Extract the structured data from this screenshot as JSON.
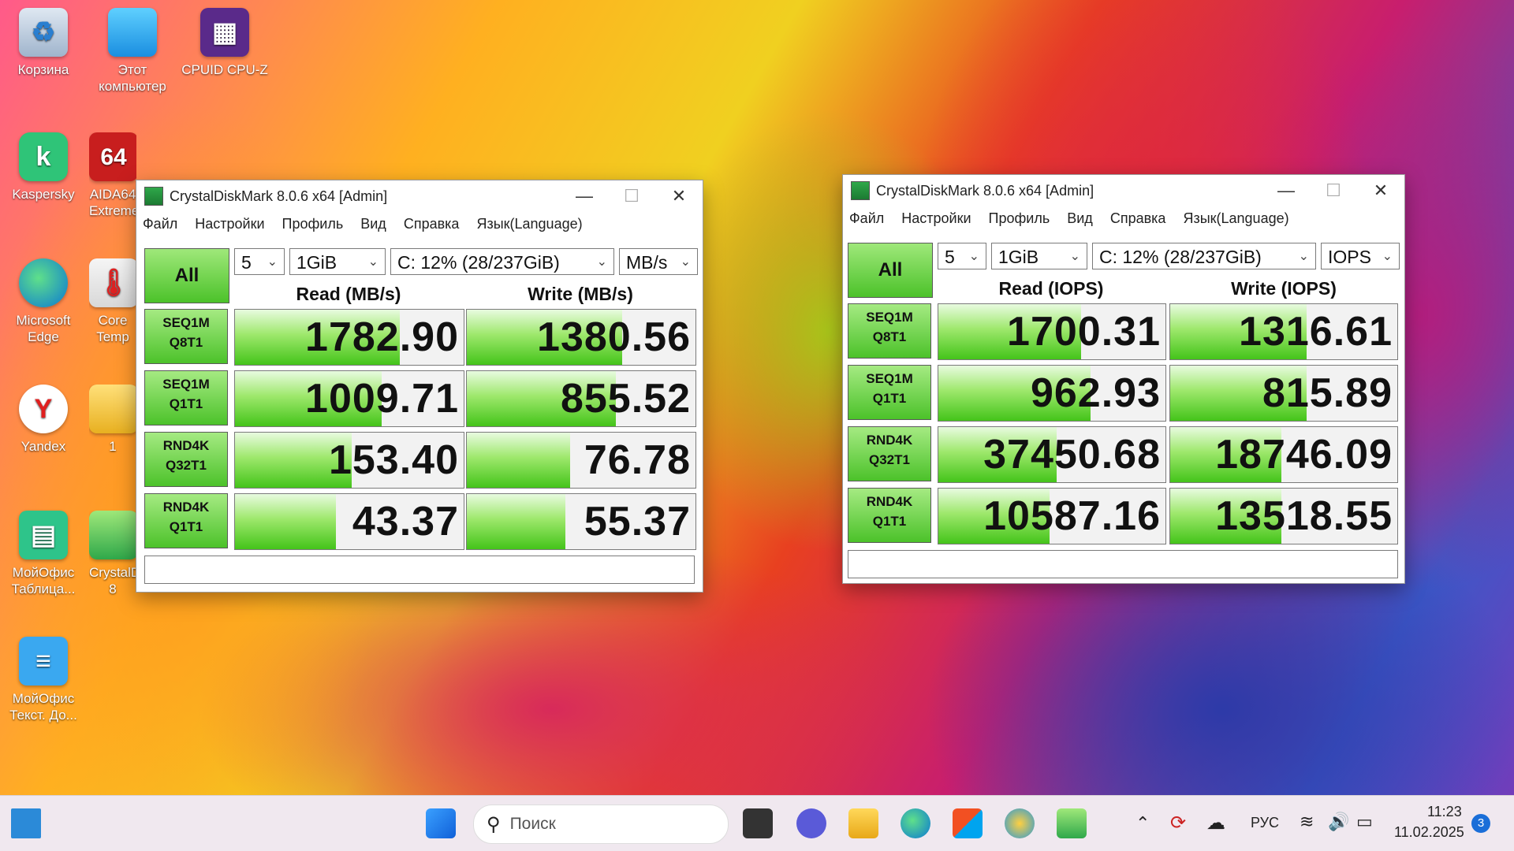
{
  "desktop": {
    "icons": [
      {
        "label": "Корзина"
      },
      {
        "label": "Этот компьютер"
      },
      {
        "label": "CPUID CPU-Z"
      },
      {
        "label": "Kaspersky"
      },
      {
        "label": "AIDA64 Extreme"
      },
      {
        "label": "Microsoft Edge"
      },
      {
        "label": "Core Temp"
      },
      {
        "label": "Yandex"
      },
      {
        "label": "1"
      },
      {
        "label": "МойОфис Таблица..."
      },
      {
        "label": "CrystalDiskMark 8"
      },
      {
        "label": "МойОфис Текст. До..."
      }
    ]
  },
  "win1": {
    "title": "CrystalDiskMark 8.0.6 x64 [Admin]",
    "menu": [
      "Файл",
      "Настройки",
      "Профиль",
      "Вид",
      "Справка",
      "Язык(Language)"
    ],
    "all": "All",
    "count": "5",
    "size": "1GiB",
    "drive": "C: 12% (28/237GiB)",
    "unit": "MB/s",
    "read_head": "Read (MB/s)",
    "write_head": "Write (MB/s)",
    "rows": [
      {
        "l1": "SEQ1M",
        "l2": "Q8T1",
        "read": "1782.90",
        "write": "1380.56",
        "rfill": 0.72,
        "wfill": 0.68
      },
      {
        "l1": "SEQ1M",
        "l2": "Q1T1",
        "read": "1009.71",
        "write": "855.52",
        "rfill": 0.64,
        "wfill": 0.65
      },
      {
        "l1": "RND4K",
        "l2": "Q32T1",
        "read": "153.40",
        "write": "76.78",
        "rfill": 0.51,
        "wfill": 0.45
      },
      {
        "l1": "RND4K",
        "l2": "Q1T1",
        "read": "43.37",
        "write": "55.37",
        "rfill": 0.44,
        "wfill": 0.43
      }
    ]
  },
  "win2": {
    "title": "CrystalDiskMark 8.0.6 x64 [Admin]",
    "menu": [
      "Файл",
      "Настройки",
      "Профиль",
      "Вид",
      "Справка",
      "Язык(Language)"
    ],
    "all": "All",
    "count": "5",
    "size": "1GiB",
    "drive": "C: 12% (28/237GiB)",
    "unit": "IOPS",
    "read_head": "Read (IOPS)",
    "write_head": "Write (IOPS)",
    "rows": [
      {
        "l1": "SEQ1M",
        "l2": "Q8T1",
        "read": "1700.31",
        "write": "1316.61",
        "rfill": 0.63,
        "wfill": 0.6
      },
      {
        "l1": "SEQ1M",
        "l2": "Q1T1",
        "read": "962.93",
        "write": "815.89",
        "rfill": 0.67,
        "wfill": 0.6
      },
      {
        "l1": "RND4K",
        "l2": "Q32T1",
        "read": "37450.68",
        "write": "18746.09",
        "rfill": 0.52,
        "wfill": 0.49
      },
      {
        "l1": "RND4K",
        "l2": "Q1T1",
        "read": "10587.16",
        "write": "13518.55",
        "rfill": 0.49,
        "wfill": 0.49
      }
    ]
  },
  "taskbar": {
    "search_placeholder": "Поиск",
    "lang": "РУС",
    "time": "11:23",
    "date": "11.02.2025",
    "notifications": "3"
  },
  "colors": {
    "accent_green": "#44c41a",
    "taskbar_bg": "#f0e8ef"
  }
}
